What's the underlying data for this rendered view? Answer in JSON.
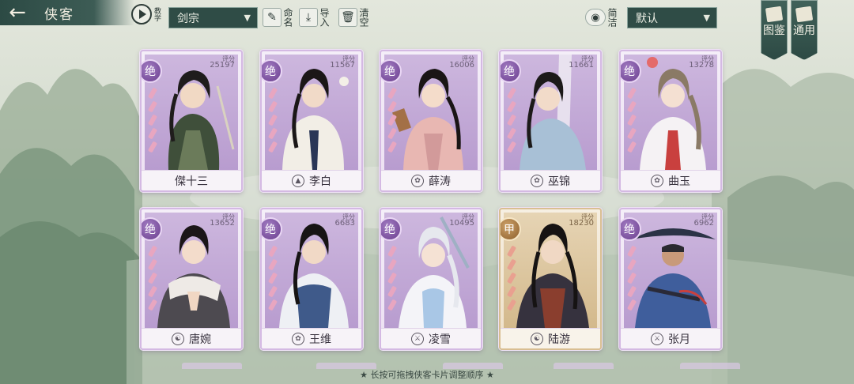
{
  "header": {
    "back_icon": "arrow-left-icon",
    "title": "侠客",
    "tutorial_label": "教学",
    "sect_filter": "剑宗",
    "name_label": "命名",
    "import_label": "导入",
    "clear_label": "清空",
    "filter_label": "简洁",
    "sort_value": "默认",
    "atlas_tab": "图鉴",
    "general_tab": "通用"
  },
  "score_label": "评分",
  "cards": [
    {
      "name": "傑十三",
      "rank": "绝",
      "score": "25197",
      "sect_icon": "",
      "theme": "purple"
    },
    {
      "name": "李白",
      "rank": "绝",
      "score": "11567",
      "sect_icon": "shield-icon",
      "theme": "purple"
    },
    {
      "name": "薛涛",
      "rank": "绝",
      "score": "16006",
      "sect_icon": "lotus-icon",
      "theme": "purple"
    },
    {
      "name": "巫锦",
      "rank": "绝",
      "score": "11661",
      "sect_icon": "lotus-icon",
      "theme": "purple"
    },
    {
      "name": "曲玉",
      "rank": "绝",
      "score": "13278",
      "sect_icon": "lotus-icon",
      "theme": "purple"
    },
    {
      "name": "唐婉",
      "rank": "绝",
      "score": "13652",
      "sect_icon": "taiji-icon",
      "theme": "purple"
    },
    {
      "name": "王维",
      "rank": "绝",
      "score": "6683",
      "sect_icon": "lotus-icon",
      "theme": "purple"
    },
    {
      "name": "凌雪",
      "rank": "绝",
      "score": "10495",
      "sect_icon": "sword-icon",
      "theme": "purple"
    },
    {
      "name": "陆游",
      "rank": "甲",
      "score": "18230",
      "sect_icon": "taiji-icon",
      "theme": "gold"
    },
    {
      "name": "张月",
      "rank": "绝",
      "score": "6962",
      "sect_icon": "sword-icon",
      "theme": "purple"
    }
  ],
  "footer": {
    "hint": "★ 长按可拖拽侠客卡片调整顺序 ★"
  },
  "colors": {
    "header_dark": "#2f4c46",
    "card_purple": "#b89ccf",
    "card_gold": "#d3b98c",
    "badge_purple": "#6b3f8f",
    "badge_gold": "#8c5e2a"
  }
}
